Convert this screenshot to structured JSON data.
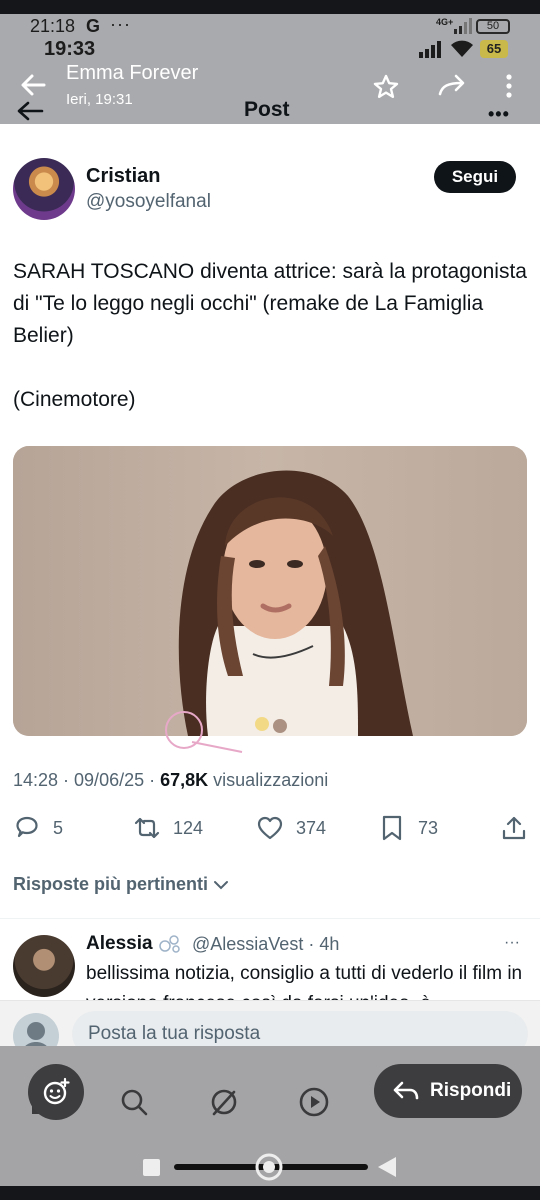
{
  "status_bar": {
    "time": "21:18",
    "carrier_glyph": "G",
    "overflow": "···",
    "network_badge": "4G+",
    "battery_small": "50",
    "app_time": "19:33",
    "battery_big": "65"
  },
  "chat_header": {
    "name": "Emma Forever",
    "subtitle": "Ieri, 19:31"
  },
  "post_header": {
    "title": "Post",
    "more": "•••"
  },
  "tweet": {
    "author_name": "Cristian",
    "author_handle": "@yosoyelfanal",
    "follow_label": "Segui",
    "text": "SARAH TOSCANO diventa attrice: sarà la protagonista di \"Te lo leggo negli occhi\" (remake de La Famiglia Belier)\n\n(Cinemotore)",
    "timestamp": "14:28 · 09/06/25 · ",
    "views_count": "67,8K",
    "views_label": "visualizzazioni",
    "replies": "5",
    "retweets": "124",
    "likes": "374",
    "bookmarks": "73"
  },
  "replies_section": {
    "sort_label": "Risposte più pertinenti"
  },
  "reply": {
    "name": "Alessia",
    "handle_time": "@AlessiaVest · 4h",
    "more": "···",
    "text": "bellissima notizia, consiglio a tutti di vederlo il film in versione francese così da farsi un'idea, è"
  },
  "compose": {
    "placeholder": "Posta la tua risposta"
  },
  "fab": {
    "reply_label": "Rispondi"
  },
  "icons": [
    "back-icon",
    "star-icon",
    "forward-icon",
    "kebab-icon",
    "reply-icon",
    "retweet-icon",
    "like-icon",
    "bookmark-icon",
    "share-icon",
    "chevron-down-icon",
    "home-icon",
    "search-icon",
    "grok-icon",
    "play-icon",
    "bell-icon",
    "mail-icon",
    "emoji-icon"
  ],
  "colors": {
    "text_primary": "#0f1419",
    "text_secondary": "#536471",
    "follow_bg": "#0f1419",
    "overlay_grey": "#a9aaad",
    "fab_bg": "#3d3d3f"
  }
}
